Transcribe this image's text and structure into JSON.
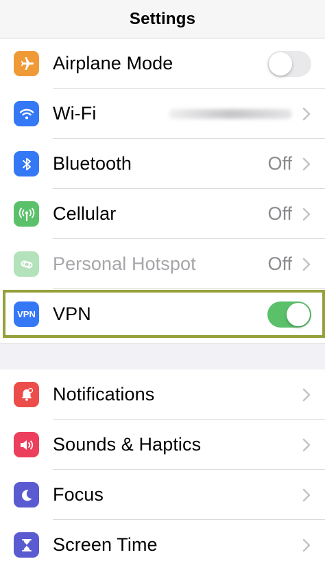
{
  "nav": {
    "title": "Settings"
  },
  "group1": [
    {
      "label": "Airplane Mode",
      "icon": "airplane-icon",
      "color": "#f09a37",
      "control": "toggle",
      "on": false
    },
    {
      "label": "Wi-Fi",
      "icon": "wifi-icon",
      "color": "#3478f6",
      "control": "chevron",
      "value": ""
    },
    {
      "label": "Bluetooth",
      "icon": "bluetooth-icon",
      "color": "#3478f6",
      "control": "chevron",
      "value": "Off"
    },
    {
      "label": "Cellular",
      "icon": "cellular-icon",
      "color": "#5ac16a",
      "control": "chevron",
      "value": "Off"
    },
    {
      "label": "Personal Hotspot",
      "icon": "hotspot-icon",
      "color": "#5ac16a",
      "control": "chevron",
      "value": "Off",
      "disabled": true
    },
    {
      "label": "VPN",
      "icon": "vpn-icon",
      "icon_text": "VPN",
      "color": "#3478f6",
      "control": "toggle",
      "on": true
    }
  ],
  "group2": [
    {
      "label": "Notifications",
      "icon": "notifications-icon",
      "color": "#ec4d4a"
    },
    {
      "label": "Sounds & Haptics",
      "icon": "sounds-icon",
      "color": "#ec3f5d"
    },
    {
      "label": "Focus",
      "icon": "focus-moon-icon",
      "color": "#5a5bd0"
    },
    {
      "label": "Screen Time",
      "icon": "screen-time-icon",
      "color": "#5a5bd0"
    }
  ],
  "highlight_color": "#96a03a"
}
